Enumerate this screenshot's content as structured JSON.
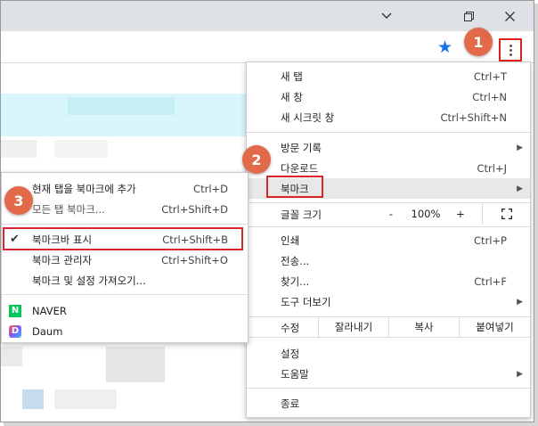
{
  "window": {
    "minimize_icon": "chevron-down-icon",
    "restore_icon": "restore-icon",
    "close_icon": "close-icon"
  },
  "toolbar": {
    "bookmark_star_icon": "star-icon",
    "menu_icon": "kebab-menu-icon"
  },
  "menu": {
    "items": {
      "new_tab": {
        "label": "새 탭",
        "shortcut": "Ctrl+T"
      },
      "new_window": {
        "label": "새 창",
        "shortcut": "Ctrl+N"
      },
      "incognito": {
        "label": "새 시크릿 창",
        "shortcut": "Ctrl+Shift+N"
      },
      "history": {
        "label": "방문 기록"
      },
      "downloads": {
        "label": "다운로드",
        "shortcut": "Ctrl+J"
      },
      "bookmarks": {
        "label": "북마크"
      },
      "print": {
        "label": "인쇄",
        "shortcut": "Ctrl+P"
      },
      "cast": {
        "label": "전송..."
      },
      "find": {
        "label": "찾기...",
        "shortcut": "Ctrl+F"
      },
      "more_tools": {
        "label": "도구 더보기"
      },
      "settings": {
        "label": "설정"
      },
      "help": {
        "label": "도움말"
      },
      "exit": {
        "label": "종료"
      }
    },
    "zoom": {
      "label": "글꼴 크기",
      "minus": "-",
      "value": "100%",
      "plus": "+"
    },
    "edit": {
      "label": "수정",
      "cut": "잘라내기",
      "copy": "복사",
      "paste": "붙여넣기"
    }
  },
  "bookmarks_submenu": {
    "items": {
      "add_tab": {
        "label": "현재 탭을 북마크에 추가",
        "shortcut": "Ctrl+D"
      },
      "all_tabs": {
        "label": "모든 탭 북마크...",
        "shortcut": "Ctrl+Shift+D"
      },
      "show_bar": {
        "label": "북마크바 표시",
        "shortcut": "Ctrl+Shift+B",
        "checked": "✔"
      },
      "manager": {
        "label": "북마크 관리자",
        "shortcut": "Ctrl+Shift+O"
      },
      "import": {
        "label": "북마크 및 설정 가져오기..."
      },
      "naver": {
        "label": "NAVER",
        "favicon": "N"
      },
      "daum": {
        "label": "Daum",
        "favicon": "D"
      }
    }
  },
  "badges": {
    "step1": "1",
    "step2": "2",
    "step3": "3"
  }
}
